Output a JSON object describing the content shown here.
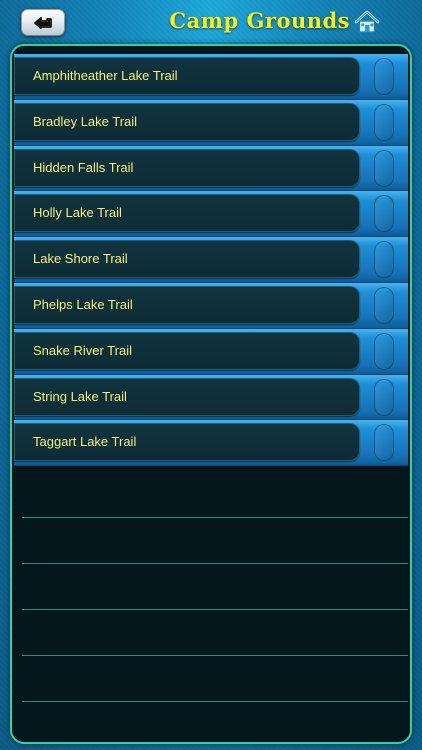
{
  "header": {
    "back_icon": "back-arrow-icon",
    "title": "Camp Grounds",
    "home_icon": "home-icon"
  },
  "trails": [
    {
      "label": "Amphitheather Lake Trail"
    },
    {
      "label": "Bradley Lake Trail"
    },
    {
      "label": "Hidden Falls Trail"
    },
    {
      "label": "Holly Lake Trail"
    },
    {
      "label": "Lake Shore Trail"
    },
    {
      "label": "Phelps Lake Trail"
    },
    {
      "label": "Snake River Trail"
    },
    {
      "label": "String Lake Trail"
    },
    {
      "label": "Taggart Lake Trail"
    }
  ],
  "colors": {
    "title": "#f6f21a",
    "label": "#f3f27a",
    "panel_border": "#32d3a0",
    "row_blue": "#1f8fd6",
    "background": "#1284b8"
  }
}
